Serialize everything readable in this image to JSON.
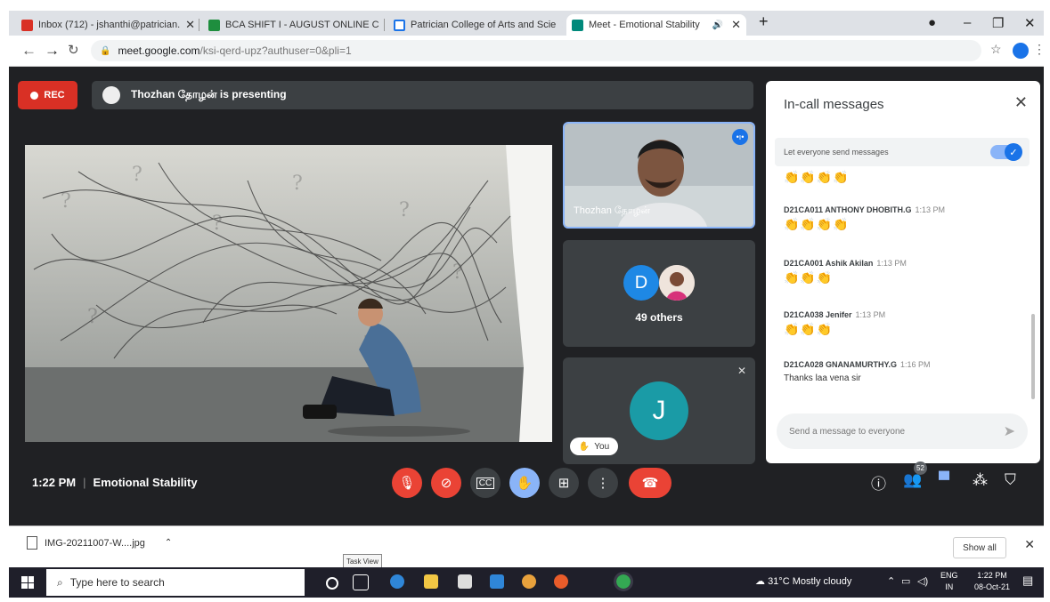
{
  "browser": {
    "tabs": [
      {
        "label": "Inbox (712) - jshanthi@patrician.",
        "icon": "gmail-icon",
        "color": "#d93025",
        "active": false
      },
      {
        "label": "BCA SHIFT I - AUGUST ONLINE C",
        "icon": "classroom-icon",
        "color": "#1e8e3e",
        "active": false
      },
      {
        "label": "Patrician College of Arts and Scie",
        "icon": "page-icon",
        "color": "#1a73e8",
        "active": false
      },
      {
        "label": "Meet - Emotional Stability",
        "icon": "meet-icon",
        "color": "#00897b",
        "active": true
      }
    ],
    "url_host": "meet.google.com",
    "url_rest": "/ksi-qerd-upz?authuser=0&pli=1"
  },
  "meet": {
    "rec_label": "REC",
    "presenting_text": "Thozhan தோழன் is presenting",
    "speaker_name": "Thozhan தோழன்",
    "others_label": "49 others",
    "avatar_d": "D",
    "self_initial": "J",
    "you_label": "You",
    "time": "1:22 PM",
    "meeting_title": "Emotional Stability",
    "participants_badge": "52"
  },
  "chat": {
    "title": "In-call messages",
    "toggle_label": "Let everyone send messages",
    "toggle_on": true,
    "top_hands": "👏👏👏👏",
    "messages": [
      {
        "sender": "D21CA011 ANTHONY DHOBITH.G",
        "time": "1:13 PM",
        "body": "👏👏👏👏"
      },
      {
        "sender": "D21CA001 Ashik Akilan",
        "time": "1:13 PM",
        "body": "👏👏👏"
      },
      {
        "sender": "D21CA038 Jenifer",
        "time": "1:13 PM",
        "body": "👏👏👏"
      },
      {
        "sender": "D21CA028 GNANAMURTHY.G",
        "time": "1:16 PM",
        "body": "Thanks laa vena sir"
      }
    ],
    "input_placeholder": "Send a message to everyone"
  },
  "downloads": {
    "file_name": "IMG-20211007-W....jpg",
    "show_all": "Show all",
    "tooltip": "Task View"
  },
  "taskbar": {
    "search_placeholder": "Type here to search",
    "weather": "31°C  Mostly cloudy",
    "lang_top": "ENG",
    "lang_bottom": "IN",
    "time": "1:22 PM",
    "date": "08-Oct-21"
  },
  "colors": {
    "rec_red": "#d93025",
    "meet_bg": "#202124",
    "tile_bg": "#3c4043",
    "accent_blue": "#1a73e8"
  }
}
